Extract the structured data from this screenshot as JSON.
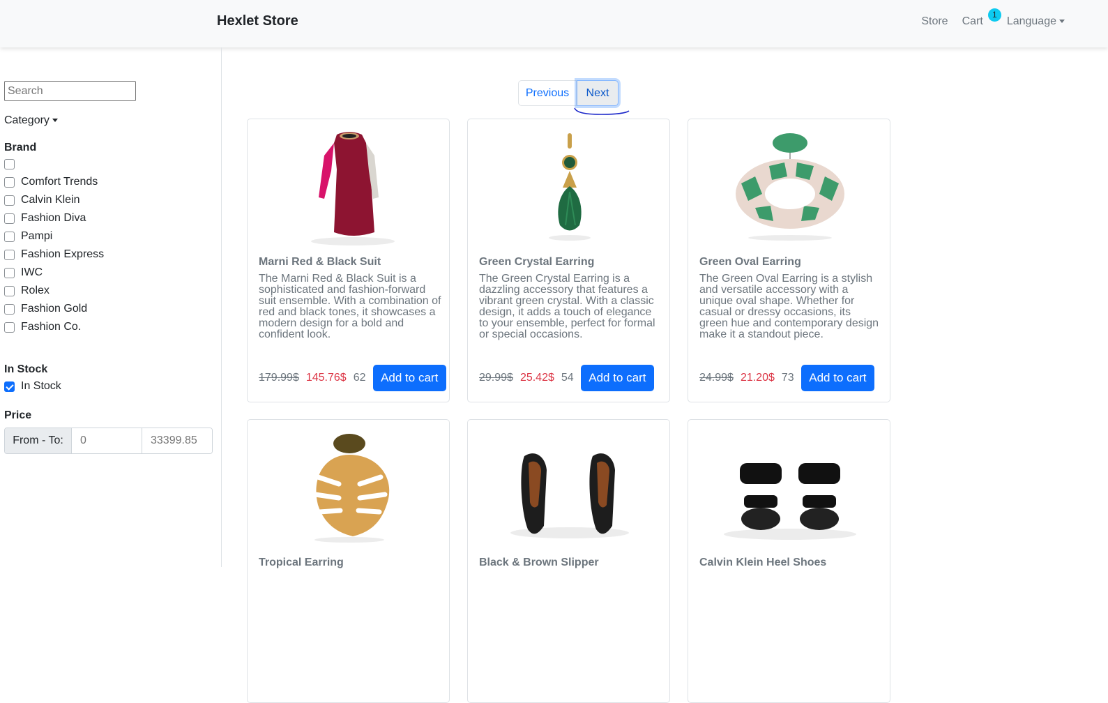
{
  "navbar": {
    "brand": "Hexlet Store",
    "links": {
      "store": "Store",
      "cart": "Cart",
      "cart_count": "1",
      "language": "Language"
    }
  },
  "sidebar": {
    "search_placeholder": "Search",
    "category_label": "Category",
    "brand_title": "Brand",
    "brands": [
      "",
      "Comfort Trends",
      "Calvin Klein",
      "Fashion Diva",
      "Pampi",
      "Fashion Express",
      "IWC",
      "Rolex",
      "Fashion Gold",
      "Fashion Co."
    ],
    "stock_title": "In Stock",
    "stock_option": "In Stock",
    "stock_checked": true,
    "price_title": "Price",
    "price_label": "From - To:",
    "price_from_placeholder": "0",
    "price_to_placeholder": "33399.85"
  },
  "pagination": {
    "previous": "Previous",
    "next": "Next"
  },
  "colors": {
    "primary": "#0d6efd",
    "danger": "#dc3545",
    "badge": "#0dcaf0"
  },
  "products": [
    {
      "title": "Marni Red & Black Suit",
      "description": "The Marni Red & Black Suit is a sophisticated and fashion-forward suit ensemble. With a combination of red and black tones, it showcases a modern design for a bold and confident look.",
      "old_price": "179.99$",
      "price": "145.76$",
      "stock": "62",
      "button": "Add to cart",
      "image": "dress-image"
    },
    {
      "title": "Green Crystal Earring",
      "description": "The Green Crystal Earring is a dazzling accessory that features a vibrant green crystal. With a classic design, it adds a touch of elegance to your ensemble, perfect for formal or special occasions.",
      "old_price": "29.99$",
      "price": "25.42$",
      "stock": "54",
      "button": "Add to cart",
      "image": "crystal-earring-image"
    },
    {
      "title": "Green Oval Earring",
      "description": "The Green Oval Earring is a stylish and versatile accessory with a unique oval shape. Whether for casual or dressy occasions, its green hue and contemporary design make it a standout piece.",
      "old_price": "24.99$",
      "price": "21.20$",
      "stock": "73",
      "button": "Add to cart",
      "image": "oval-earring-image"
    },
    {
      "title": "Tropical Earring",
      "image": "tropical-earring-image"
    },
    {
      "title": "Black & Brown Slipper",
      "image": "slipper-image"
    },
    {
      "title": "Calvin Klein Heel Shoes",
      "image": "heel-shoes-image"
    }
  ]
}
